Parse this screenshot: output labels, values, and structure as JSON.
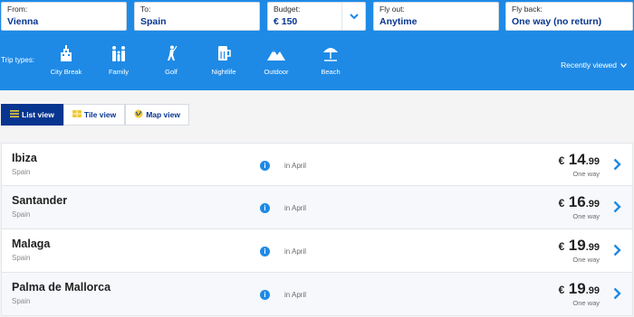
{
  "search": {
    "from_label": "From:",
    "from_value": "Vienna",
    "to_label": "To:",
    "to_value": "Spain",
    "budget_label": "Budget:",
    "budget_value": "€ 150",
    "flyout_label": "Fly out:",
    "flyout_value": "Anytime",
    "flyback_label": "Fly back:",
    "flyback_value": "One way (no return)"
  },
  "trip_types": {
    "label": "Trip types:",
    "items": [
      {
        "label": "City Break",
        "icon": "city-icon"
      },
      {
        "label": "Family",
        "icon": "family-icon"
      },
      {
        "label": "Golf",
        "icon": "golf-icon"
      },
      {
        "label": "Nightlife",
        "icon": "drink-icon"
      },
      {
        "label": "Outdoor",
        "icon": "mountain-icon"
      },
      {
        "label": "Beach",
        "icon": "umbrella-icon"
      }
    ]
  },
  "recently_viewed": "Recently viewed",
  "views": {
    "list": "List view",
    "tile": "Tile view",
    "map": "Map view"
  },
  "results": [
    {
      "city": "Ibiza",
      "country": "Spain",
      "when": "in April",
      "currency": "€",
      "price_int": "14",
      "price_dec": ".99",
      "fare_type": "One way"
    },
    {
      "city": "Santander",
      "country": "Spain",
      "when": "in April",
      "currency": "€",
      "price_int": "16",
      "price_dec": ".99",
      "fare_type": "One way"
    },
    {
      "city": "Malaga",
      "country": "Spain",
      "when": "in April",
      "currency": "€",
      "price_int": "19",
      "price_dec": ".99",
      "fare_type": "One way"
    },
    {
      "city": "Palma de Mallorca",
      "country": "Spain",
      "when": "in April",
      "currency": "€",
      "price_int": "19",
      "price_dec": ".99",
      "fare_type": "One way"
    }
  ],
  "colors": {
    "header_blue": "#1e8ae6",
    "dark_blue": "#073590",
    "accent_yellow": "#f1c933"
  }
}
